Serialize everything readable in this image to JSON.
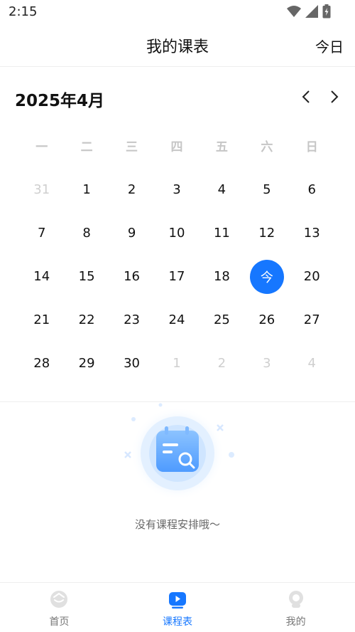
{
  "status_bar": {
    "time": "2:15"
  },
  "nav": {
    "title": "我的课表",
    "today_button": "今日"
  },
  "calendar": {
    "month_label": "2025年4月",
    "weekdays": [
      "一",
      "二",
      "三",
      "四",
      "五",
      "六",
      "日"
    ],
    "weeks": [
      [
        {
          "d": "31",
          "muted": true
        },
        {
          "d": "1"
        },
        {
          "d": "2"
        },
        {
          "d": "3"
        },
        {
          "d": "4"
        },
        {
          "d": "5"
        },
        {
          "d": "6"
        }
      ],
      [
        {
          "d": "7"
        },
        {
          "d": "8"
        },
        {
          "d": "9"
        },
        {
          "d": "10"
        },
        {
          "d": "11"
        },
        {
          "d": "12"
        },
        {
          "d": "13"
        }
      ],
      [
        {
          "d": "14"
        },
        {
          "d": "15"
        },
        {
          "d": "16"
        },
        {
          "d": "17"
        },
        {
          "d": "18"
        },
        {
          "d": "今",
          "today": true
        },
        {
          "d": "20"
        }
      ],
      [
        {
          "d": "21"
        },
        {
          "d": "22"
        },
        {
          "d": "23"
        },
        {
          "d": "24"
        },
        {
          "d": "25"
        },
        {
          "d": "26"
        },
        {
          "d": "27"
        }
      ],
      [
        {
          "d": "28"
        },
        {
          "d": "29"
        },
        {
          "d": "30"
        },
        {
          "d": "1",
          "muted": true
        },
        {
          "d": "2",
          "muted": true
        },
        {
          "d": "3",
          "muted": true
        },
        {
          "d": "4",
          "muted": true
        }
      ]
    ],
    "accent_color": "#1677ff"
  },
  "empty_state": {
    "message": "没有课程安排哦～"
  },
  "tabs": [
    {
      "label": "首页",
      "icon": "home-icon",
      "active": false
    },
    {
      "label": "课程表",
      "icon": "schedule-play-icon",
      "active": true
    },
    {
      "label": "我的",
      "icon": "profile-icon",
      "active": false
    }
  ]
}
